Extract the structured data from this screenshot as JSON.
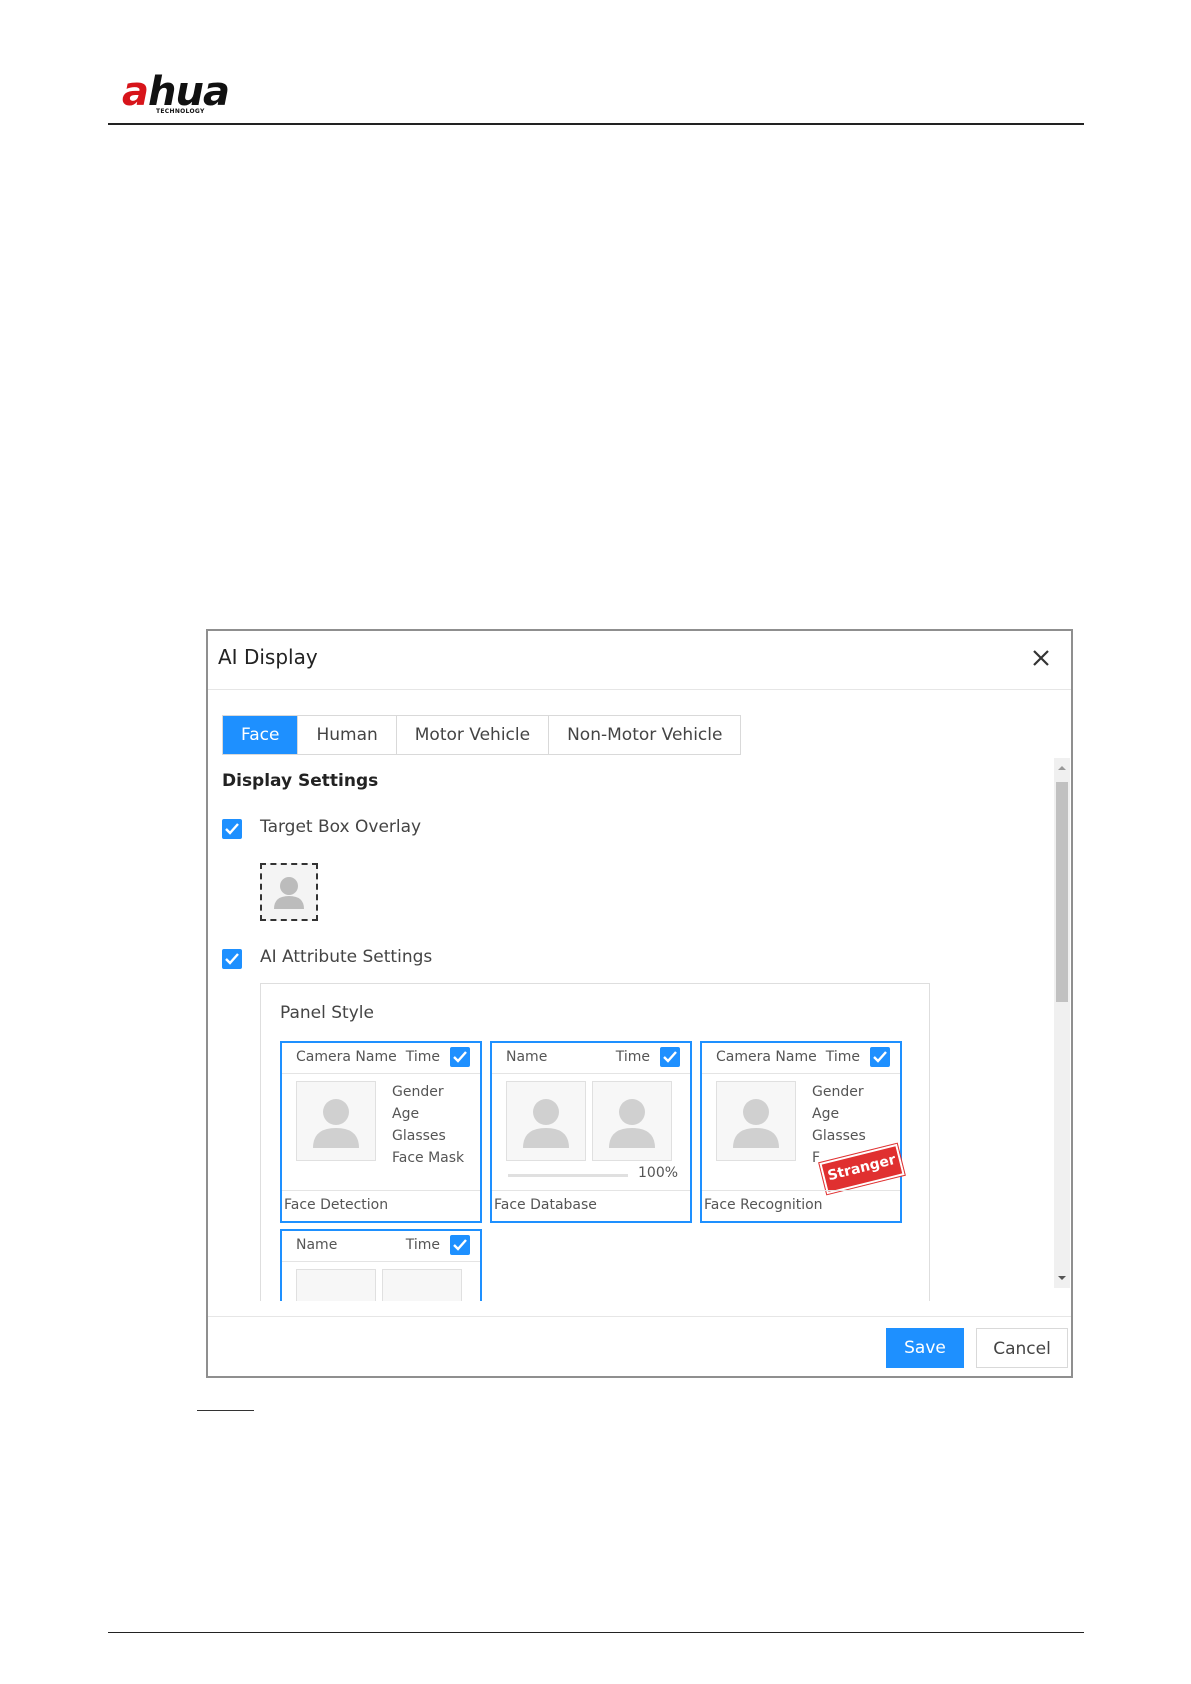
{
  "brand": {
    "logo_text_a": "a",
    "logo_text_rest": "hua",
    "logo_sub": "TECHNOLOGY",
    "accent": "#1e90ff",
    "logo_color": "#d7141a"
  },
  "dialog": {
    "title": "AI Display",
    "close_icon": "close-icon",
    "tabs": [
      {
        "label": "Face",
        "active": true
      },
      {
        "label": "Human",
        "active": false
      },
      {
        "label": "Motor Vehicle",
        "active": false
      },
      {
        "label": "Non-Motor Vehicle",
        "active": false
      }
    ],
    "display_settings_title": "Display Settings",
    "target_box_overlay": {
      "label": "Target Box Overlay",
      "checked": true
    },
    "ai_attribute_settings": {
      "label": "AI Attribute Settings",
      "checked": true
    },
    "panel_style": {
      "title": "Panel Style",
      "cards": [
        {
          "head_left": "Camera Name",
          "head_right": "Time",
          "attrs": [
            "Gender",
            "Age",
            "Glasses",
            "Face Mask"
          ],
          "footer": "Face Detection"
        },
        {
          "head_left": "Name",
          "head_right": "Time",
          "similarity": "100%",
          "footer": "Face Database"
        },
        {
          "head_left": "Camera Name",
          "head_right": "Time",
          "attrs": [
            "Gender",
            "Age",
            "Glasses",
            "F"
          ],
          "stamp": "Stranger",
          "footer": "Face Recognition"
        },
        {
          "head_left": "Name",
          "head_right": "Time"
        }
      ]
    },
    "buttons": {
      "save": "Save",
      "cancel": "Cancel"
    }
  }
}
